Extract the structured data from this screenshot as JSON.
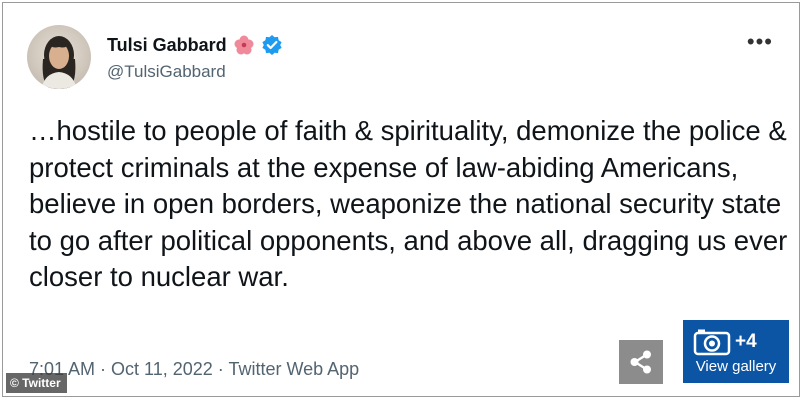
{
  "tweet": {
    "author_name": "Tulsi Gabbard",
    "handle": "@TulsiGabbard",
    "text": "…hostile to people of faith & spirituality, demonize the police & protect criminals at the expense of law-abiding Americans, believe in open borders, weaponize the national security state to go after political opponents, and above all, dragging us ever closer to nuclear war.",
    "meta": "7:01 AM · Oct 11, 2022 · Twitter Web App",
    "more_icon": "more-horizontal-icon",
    "name_emoji_icon": "hibiscus-flower-icon",
    "verified_icon": "verified-badge-icon",
    "verified_color": "#1d9bf0"
  },
  "overlay": {
    "credit": "© Twitter",
    "gallery_count": "+4",
    "gallery_label": "View gallery",
    "gallery_color": "#0c55a4",
    "share_icon": "share-icon",
    "camera_icon": "camera-icon"
  }
}
